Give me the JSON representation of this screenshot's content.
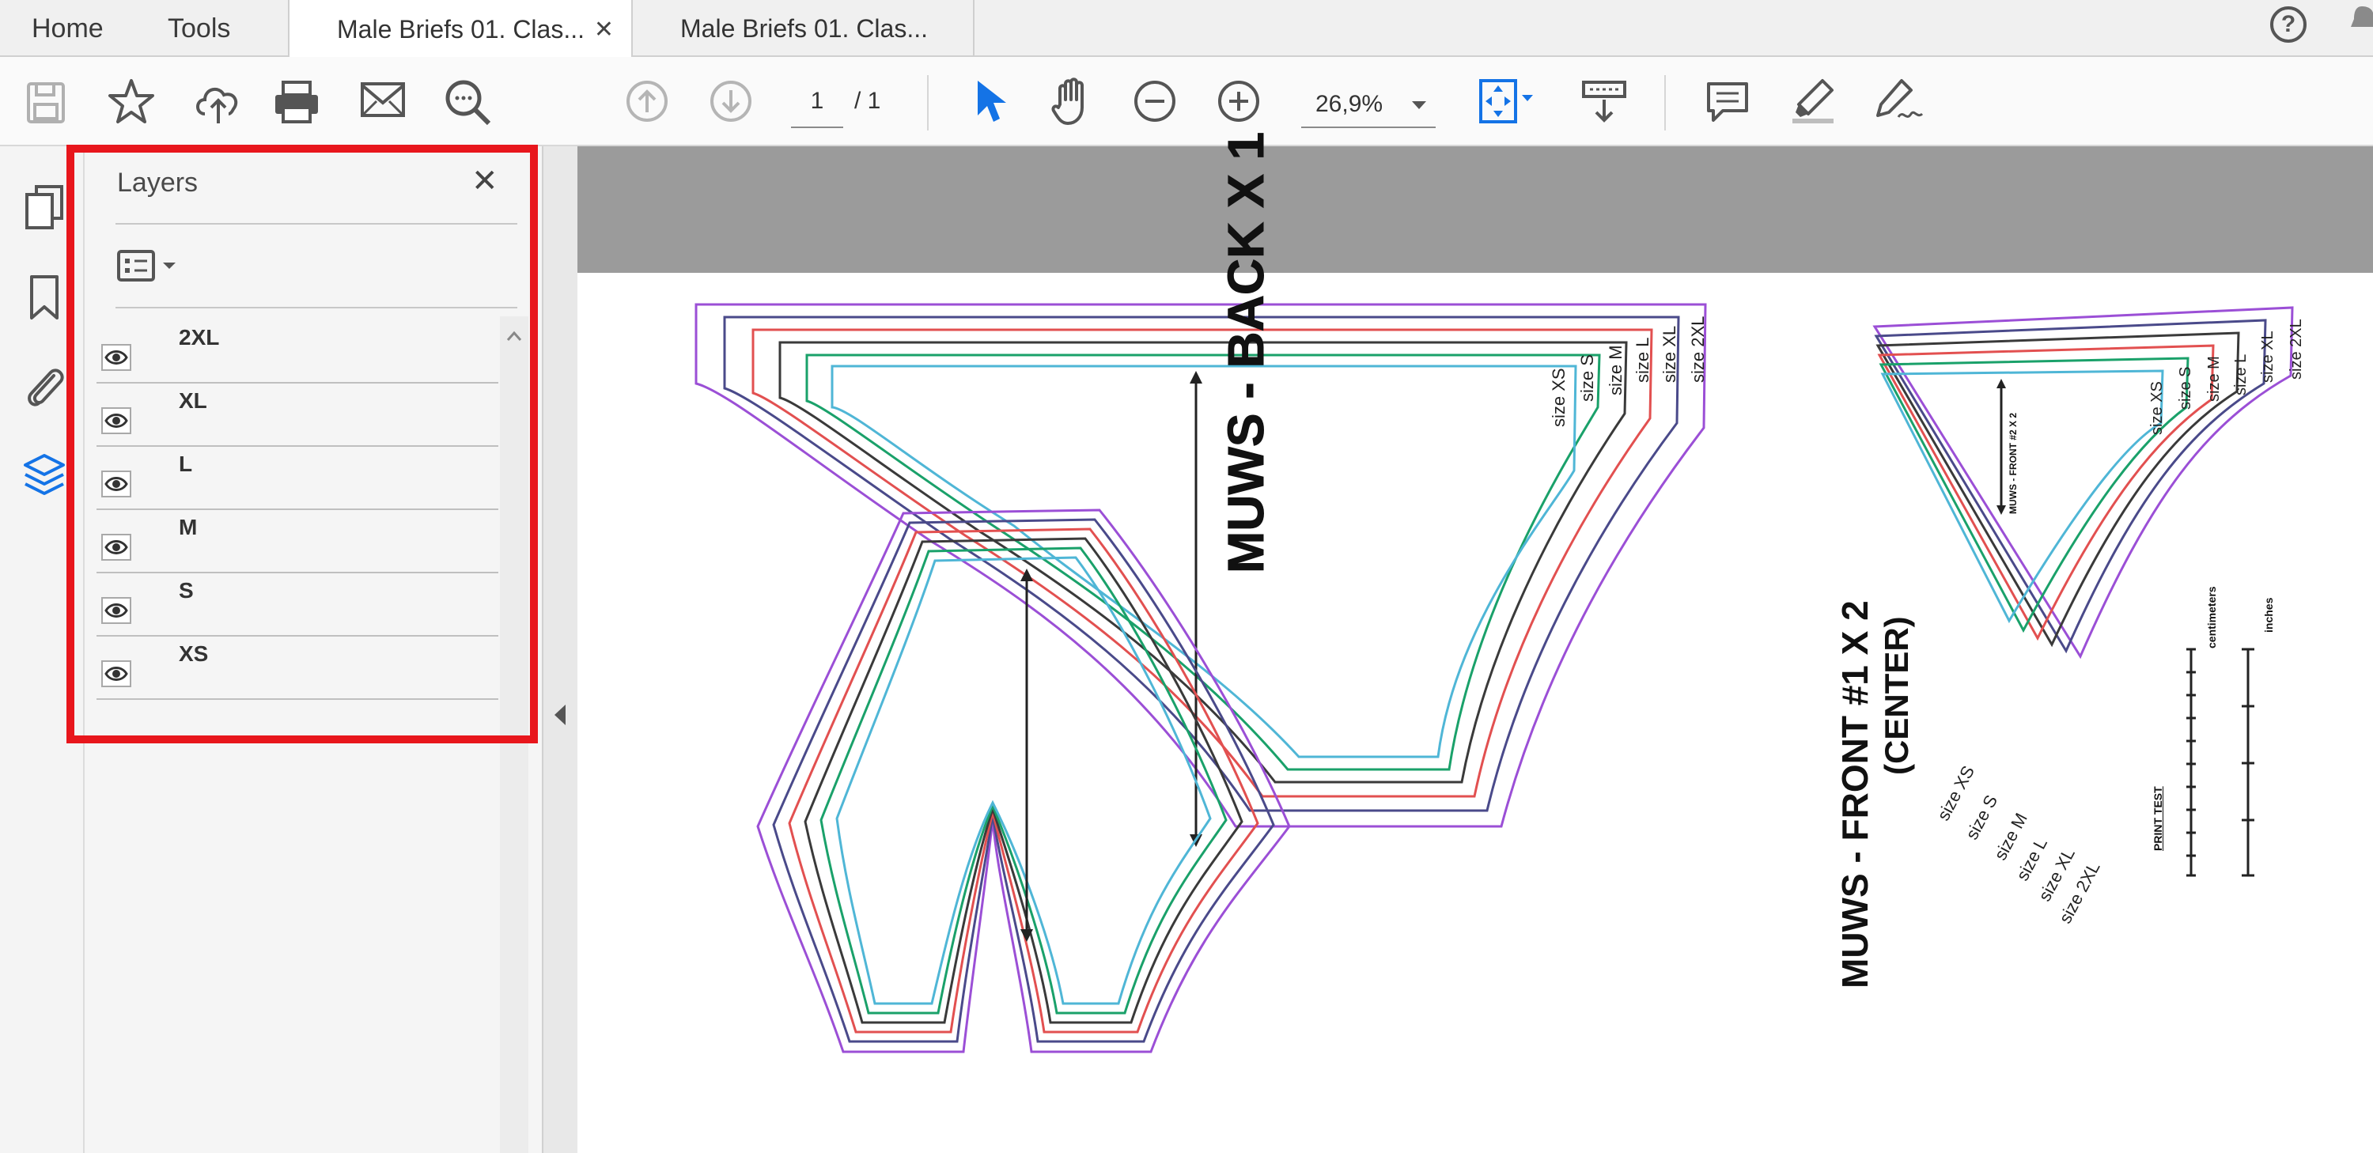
{
  "tabs": {
    "home": "Home",
    "tools": "Tools",
    "documents": [
      {
        "title": "Male Briefs 01. Clas...",
        "active": true,
        "close": "✕"
      },
      {
        "title": "Male Briefs 01. Clas...",
        "active": false
      }
    ]
  },
  "help": "?",
  "toolbar": {
    "page_current": "1",
    "page_total": "/ 1",
    "zoom": "26,9%"
  },
  "layers_panel": {
    "title": "Layers",
    "close": "✕",
    "items": [
      "2XL",
      "XL",
      "L",
      "M",
      "S",
      "XS"
    ]
  },
  "document": {
    "back_title": "MUWS - BACK X 1",
    "front_title": "MUWS - FRONT #1 X 2",
    "front_subtitle": "(CENTER)",
    "side_title": "MUWS - FRONT #2 X 2",
    "size_labels_back": [
      "size XS",
      "size S",
      "size M",
      "size L",
      "size XL",
      "size 2XL"
    ],
    "size_labels_front": [
      "size XS",
      "size S",
      "size M",
      "size L",
      "size XL",
      "size 2XL"
    ],
    "size_labels_side": [
      "size XS",
      "size S",
      "size M",
      "size L",
      "size XL",
      "size 2XL"
    ],
    "print_test": "PRINT TEST",
    "cm_label": "centimeters",
    "inch_label": "inches",
    "size_colors": {
      "XS": "#4fb6d6",
      "S": "#1aa16a",
      "M": "#3a3a3a",
      "L": "#e25050",
      "XL": "#4a4a8a",
      "2XL": "#9b4fd6"
    }
  },
  "highlight_color": "#e8161c"
}
